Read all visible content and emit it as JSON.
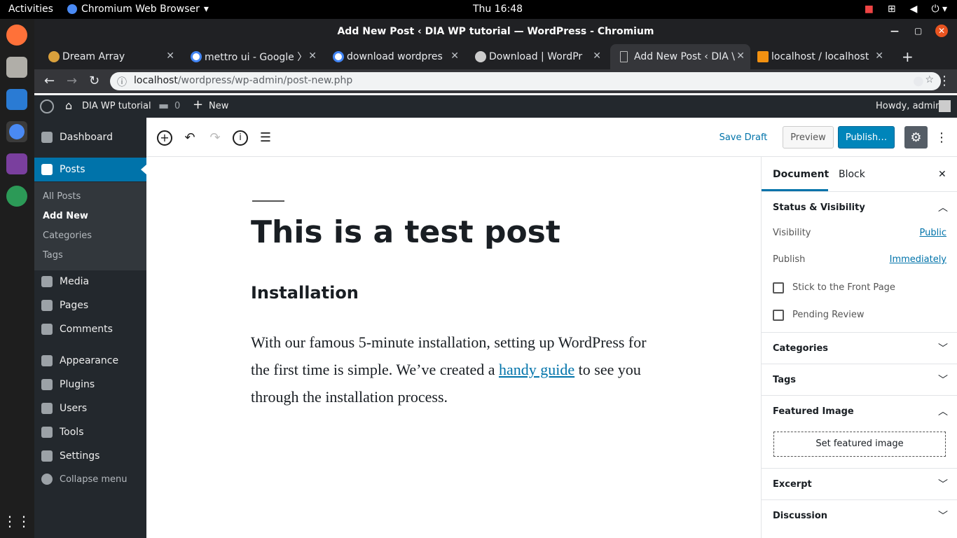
{
  "desktop": {
    "activities": "Activities",
    "app_name": "Chromium Web Browser",
    "clock": "Thu 16:48"
  },
  "window": {
    "title": "Add New Post ‹ DIA WP tutorial — WordPress - Chromium"
  },
  "tabs": [
    {
      "label": "Dream Array"
    },
    {
      "label": "mettro ui - Google 〉"
    },
    {
      "label": "download wordpres"
    },
    {
      "label": "Download | WordPr"
    },
    {
      "label": "Add New Post ‹ DIA \\"
    },
    {
      "label": "localhost / localhost"
    }
  ],
  "address": {
    "host": "localhost",
    "path": "/wordpress/wp-admin/post-new.php"
  },
  "adminbar": {
    "site": "DIA WP tutorial",
    "comments": "0",
    "new": "New",
    "howdy": "Howdy, admin"
  },
  "sidebar": {
    "dashboard": "Dashboard",
    "posts": "Posts",
    "submenu": [
      "All Posts",
      "Add New",
      "Categories",
      "Tags"
    ],
    "media": "Media",
    "pages": "Pages",
    "comments": "Comments",
    "appearance": "Appearance",
    "plugins": "Plugins",
    "users": "Users",
    "tools": "Tools",
    "settings": "Settings",
    "collapse": "Collapse menu"
  },
  "toolbar": {
    "save_draft": "Save Draft",
    "preview": "Preview",
    "publish": "Publish…"
  },
  "post": {
    "title": "This is a test post",
    "heading": "Installation",
    "para_before": "With our famous 5-minute installation, setting up WordPress for the first time is simple. We’ve created a ",
    "link": "handy guide",
    "para_after": " to see you through the installation process."
  },
  "panel": {
    "tab_document": "Document",
    "tab_block": "Block",
    "status_title": "Status & Visibility",
    "visibility_label": "Visibility",
    "visibility_value": "Public",
    "publish_label": "Publish",
    "publish_value": "Immediately",
    "stick": "Stick to the Front Page",
    "pending": "Pending Review",
    "categories": "Categories",
    "tags": "Tags",
    "featured": "Featured Image",
    "set_featured": "Set featured image",
    "excerpt": "Excerpt",
    "discussion": "Discussion"
  }
}
